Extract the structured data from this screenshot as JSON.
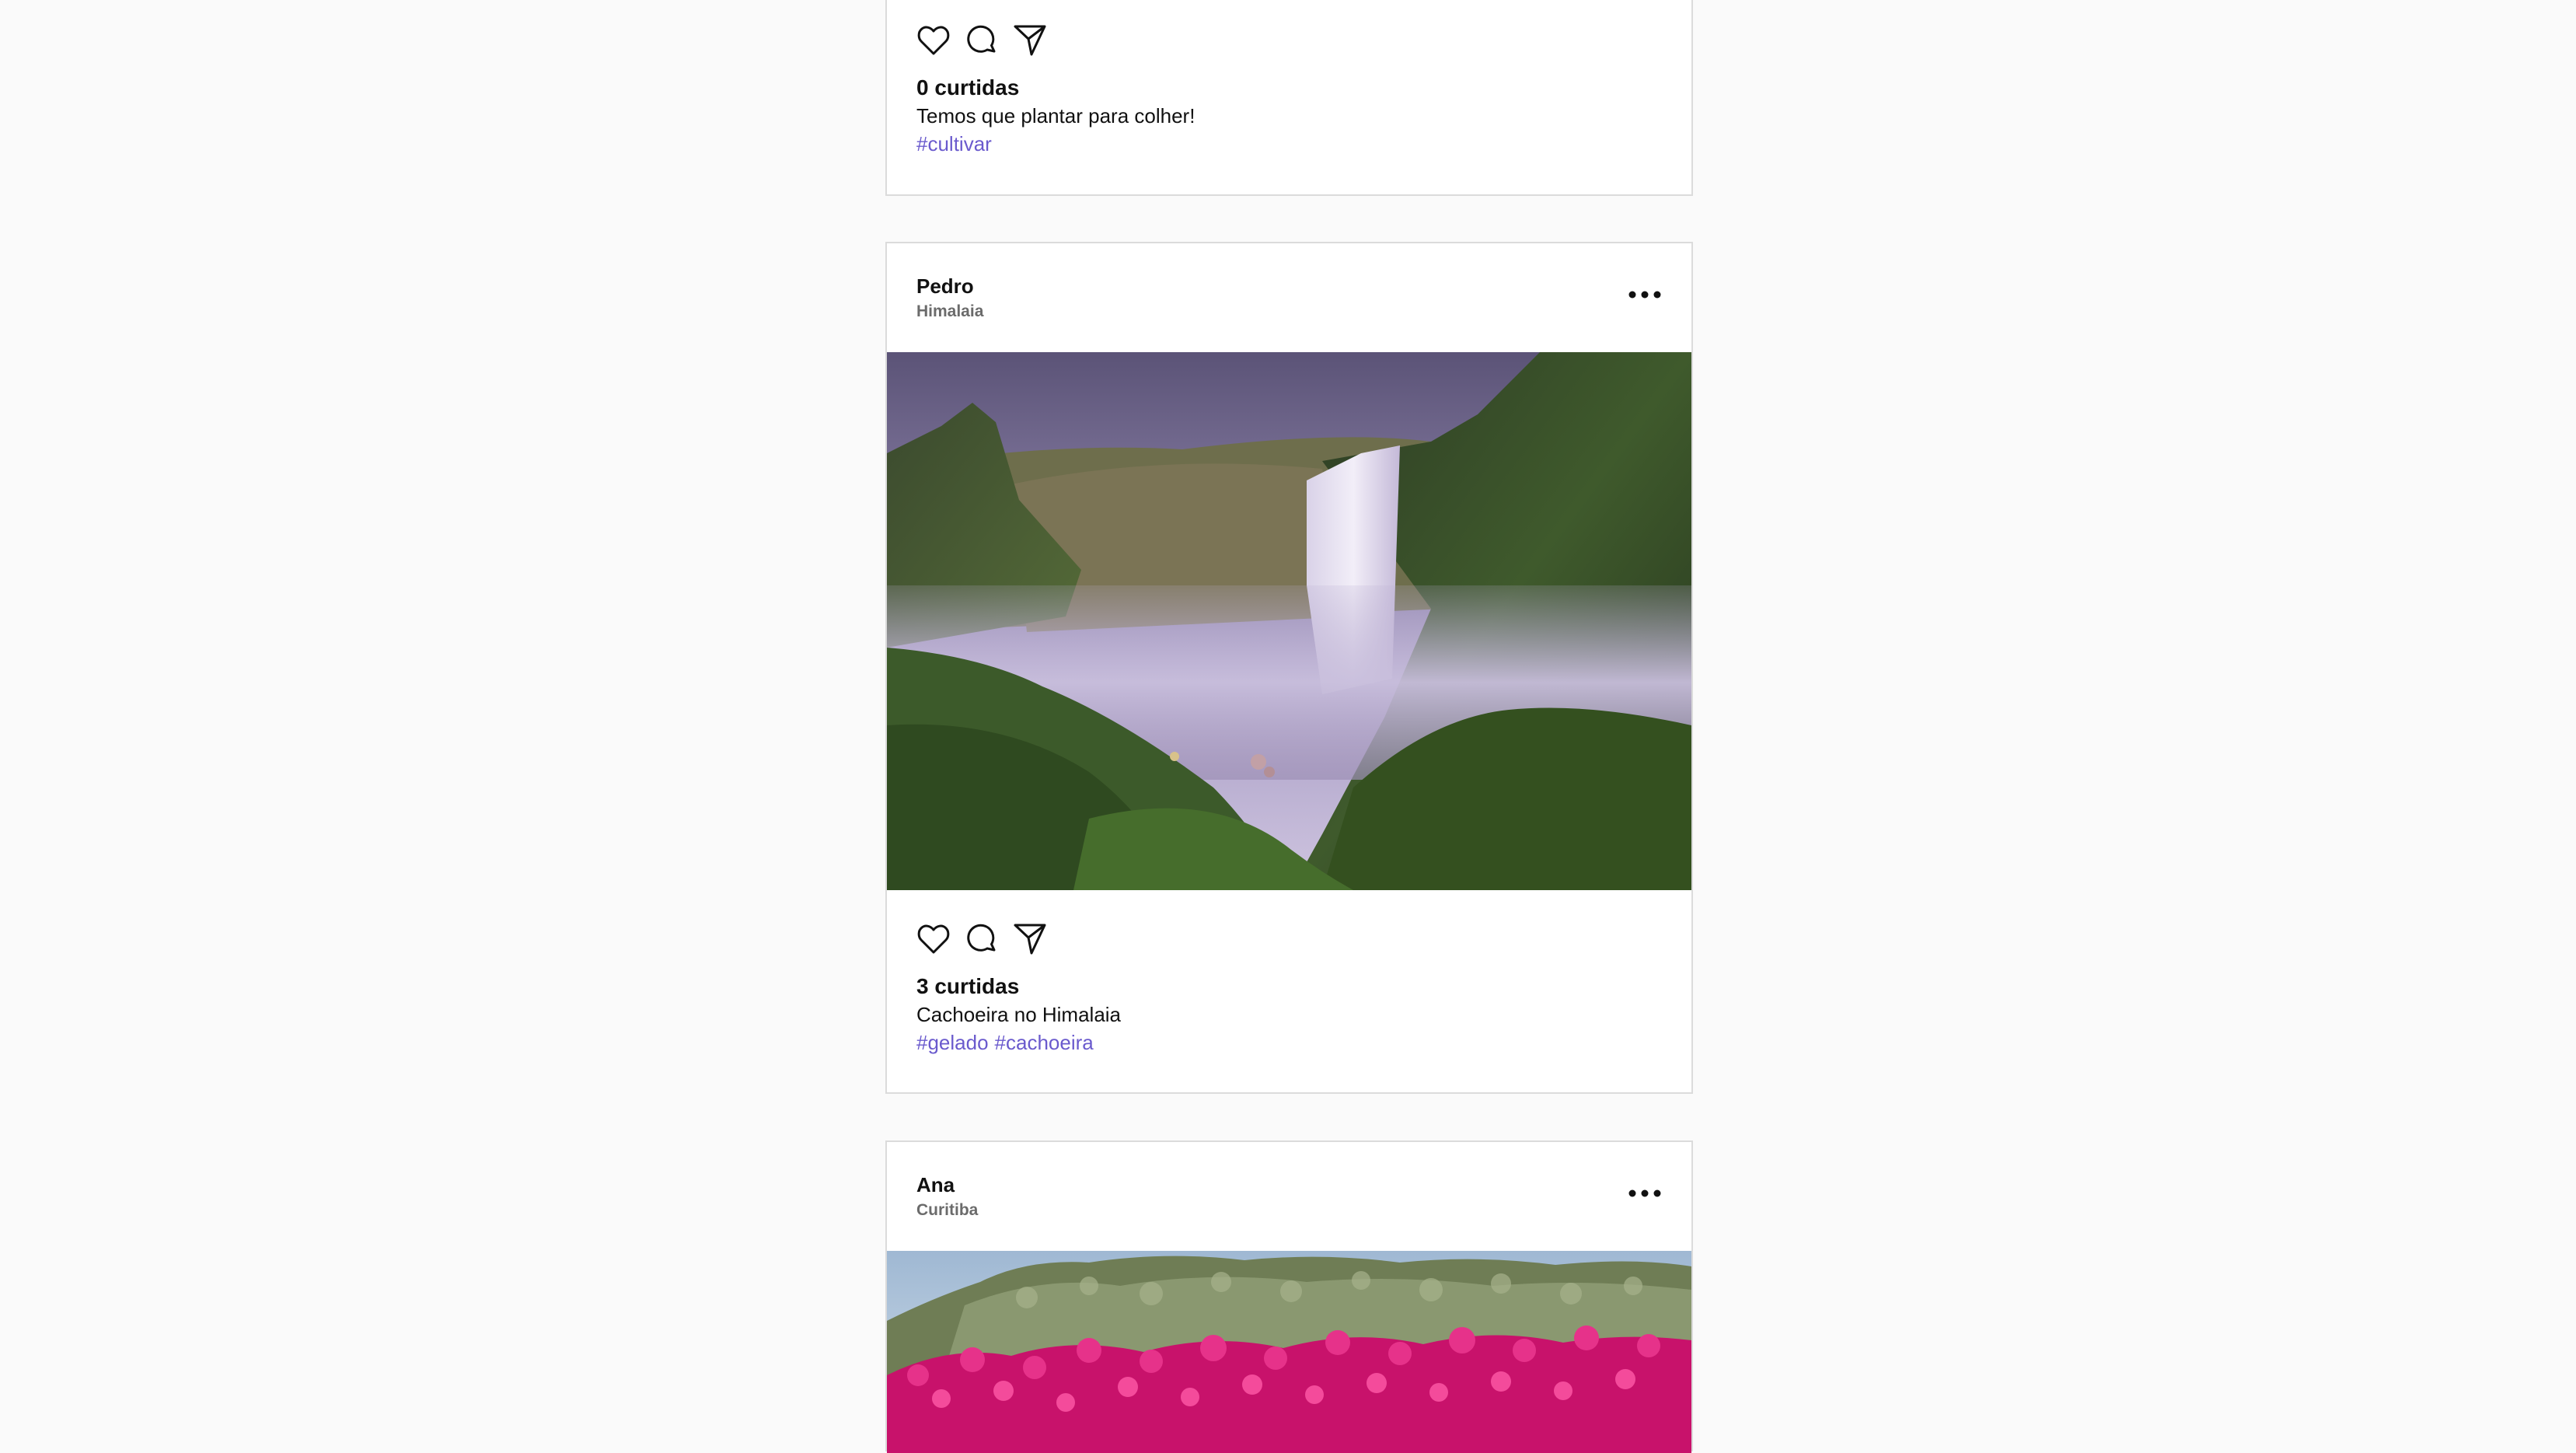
{
  "posts": [
    {
      "likes": "0 curtidas",
      "caption": "Temos que plantar para colher!",
      "tags": [
        "#cultivar"
      ]
    },
    {
      "username": "Pedro",
      "location": "Himalaia",
      "image_subject": "waterfall",
      "likes": "3 curtidas",
      "caption": "Cachoeira no Himalaia",
      "tags": [
        "#gelado",
        "#cachoeira"
      ]
    },
    {
      "username": "Ana",
      "location": "Curitiba",
      "image_subject": "pink flowers"
    }
  ],
  "colors": {
    "page_bg": "#fafafa",
    "card_bg": "#ffffff",
    "card_border": "#dbdbdb",
    "hashtag": "#6a5acd",
    "location_text": "#6b6b6b"
  },
  "icons": [
    "heart-icon",
    "comment-icon",
    "share-icon",
    "more-options-icon"
  ]
}
